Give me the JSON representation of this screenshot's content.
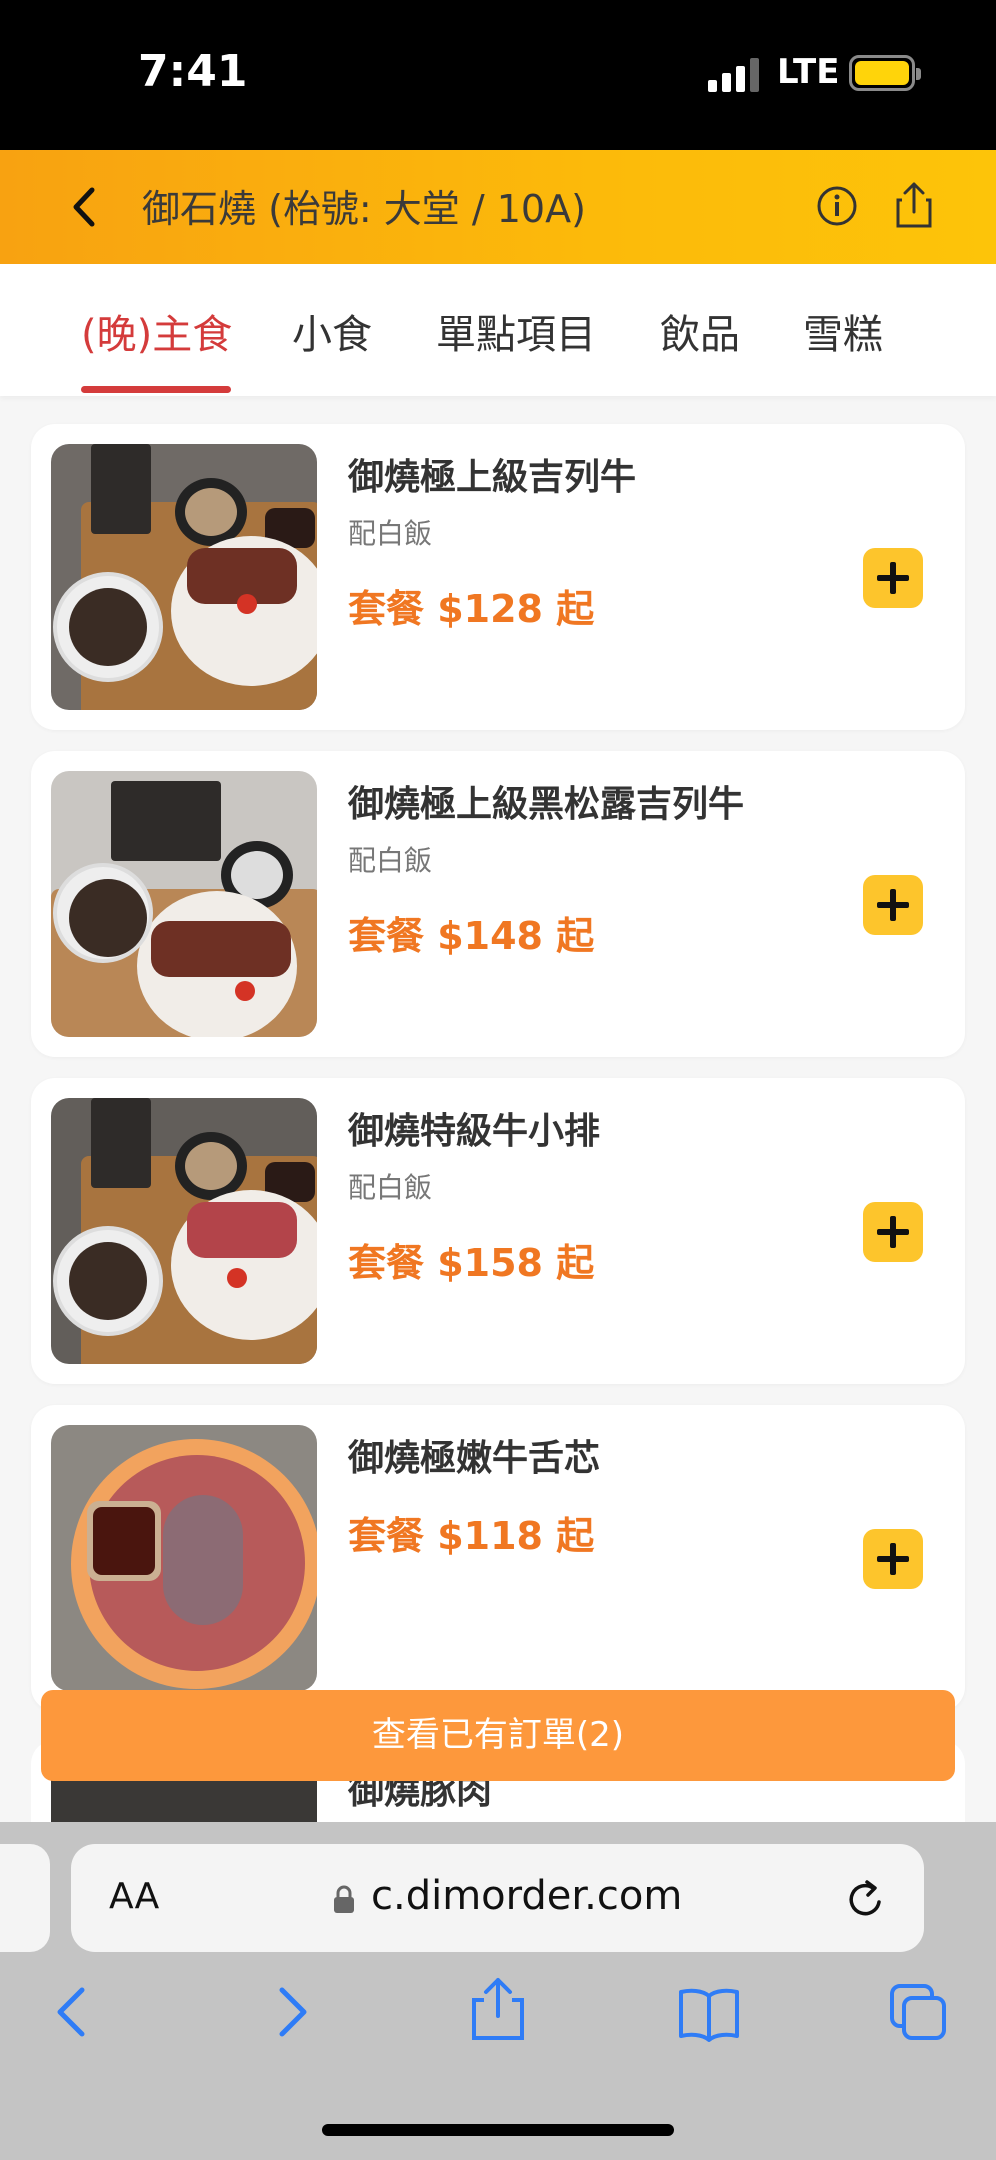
{
  "status_bar": {
    "time": "7:41",
    "network": "LTE"
  },
  "header": {
    "title": "御石燒 (枱號: 大堂 / 10A)"
  },
  "tabs": [
    "(晚)主食",
    "小食",
    "單點項目",
    "飲品",
    "雪糕"
  ],
  "active_tab_index": 0,
  "menu_items": [
    {
      "name": "御燒極上級吉列牛",
      "subtitle": "配白飯",
      "price": "套餐 $128 起"
    },
    {
      "name": "御燒極上級黑松露吉列牛",
      "subtitle": "配白飯",
      "price": "套餐 $148 起"
    },
    {
      "name": "御燒特級牛小排",
      "subtitle": "配白飯",
      "price": "套餐 $158 起"
    },
    {
      "name": "御燒極嫩牛舌芯",
      "subtitle": "",
      "price": "套餐 $118 起"
    },
    {
      "name": "御燒豚肉",
      "subtitle": "",
      "price": ""
    }
  ],
  "order_button": {
    "label": "查看已有訂單(2)"
  },
  "browser": {
    "text_size_label": "AA",
    "url": "c.dimorder.com"
  },
  "colors": {
    "accent_red": "#d43b3b",
    "price_orange": "#f07722",
    "add_yellow": "#fdc52c",
    "order_orange": "#fd983c",
    "ios_blue": "#2f7cf6"
  }
}
